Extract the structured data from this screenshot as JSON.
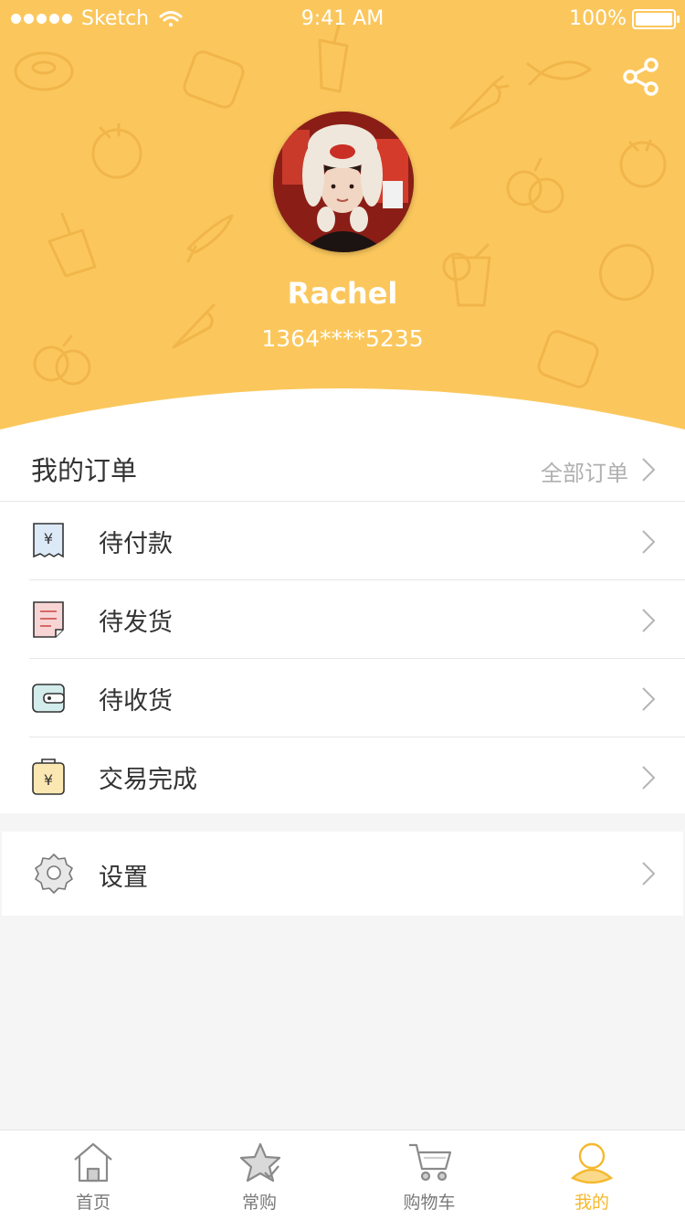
{
  "status_bar": {
    "carrier": "Sketch",
    "time": "9:41 AM",
    "battery": "100%",
    "battery_level": 1.0
  },
  "profile": {
    "name": "Rachel",
    "phone": "1364****5235"
  },
  "orders": {
    "title": "我的订单",
    "all_label": "全部订单",
    "items": [
      {
        "label": "待付款",
        "icon": "pending-payment-icon",
        "color": "#dce9f7"
      },
      {
        "label": "待发货",
        "icon": "pending-shipment-icon",
        "color": "#f7d5d5"
      },
      {
        "label": "待收货",
        "icon": "pending-receipt-icon",
        "color": "#d3ecec"
      },
      {
        "label": "交易完成",
        "icon": "transaction-complete-icon",
        "color": "#fbe7b2"
      }
    ]
  },
  "settings": {
    "label": "设置",
    "icon": "gear-icon"
  },
  "tabbar": {
    "items": [
      {
        "label": "首页",
        "icon": "home-icon",
        "active": false
      },
      {
        "label": "常购",
        "icon": "star-icon",
        "active": false
      },
      {
        "label": "购物车",
        "icon": "cart-icon",
        "active": false
      },
      {
        "label": "我的",
        "icon": "user-icon",
        "active": true
      }
    ]
  },
  "colors": {
    "brand": "#fbc75c",
    "active_tab": "#f5b82e",
    "text": "#333333",
    "muted": "#b0b0b0"
  }
}
